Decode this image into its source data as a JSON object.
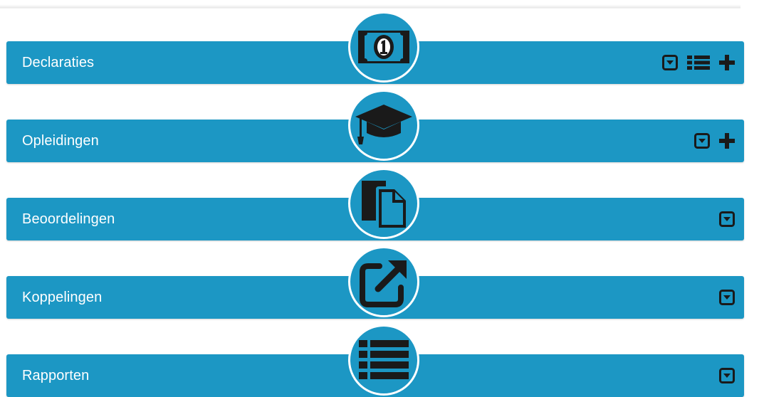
{
  "colors": {
    "bar": "#1c97c4",
    "icon": "#1a1a1a",
    "title_text": "#ffffff"
  },
  "sections": [
    {
      "title": "Declaraties",
      "icon": "money-bill-icon",
      "actions": [
        "collapse-toggle-icon",
        "list-icon",
        "plus-icon"
      ]
    },
    {
      "title": "Opleidingen",
      "icon": "graduation-cap-icon",
      "actions": [
        "collapse-toggle-icon",
        "plus-icon"
      ]
    },
    {
      "title": "Beoordelingen",
      "icon": "copy-documents-icon",
      "actions": [
        "collapse-toggle-icon"
      ]
    },
    {
      "title": "Koppelingen",
      "icon": "external-link-icon",
      "actions": [
        "collapse-toggle-icon"
      ]
    },
    {
      "title": "Rapporten",
      "icon": "list-icon",
      "actions": [
        "collapse-toggle-icon"
      ]
    }
  ]
}
